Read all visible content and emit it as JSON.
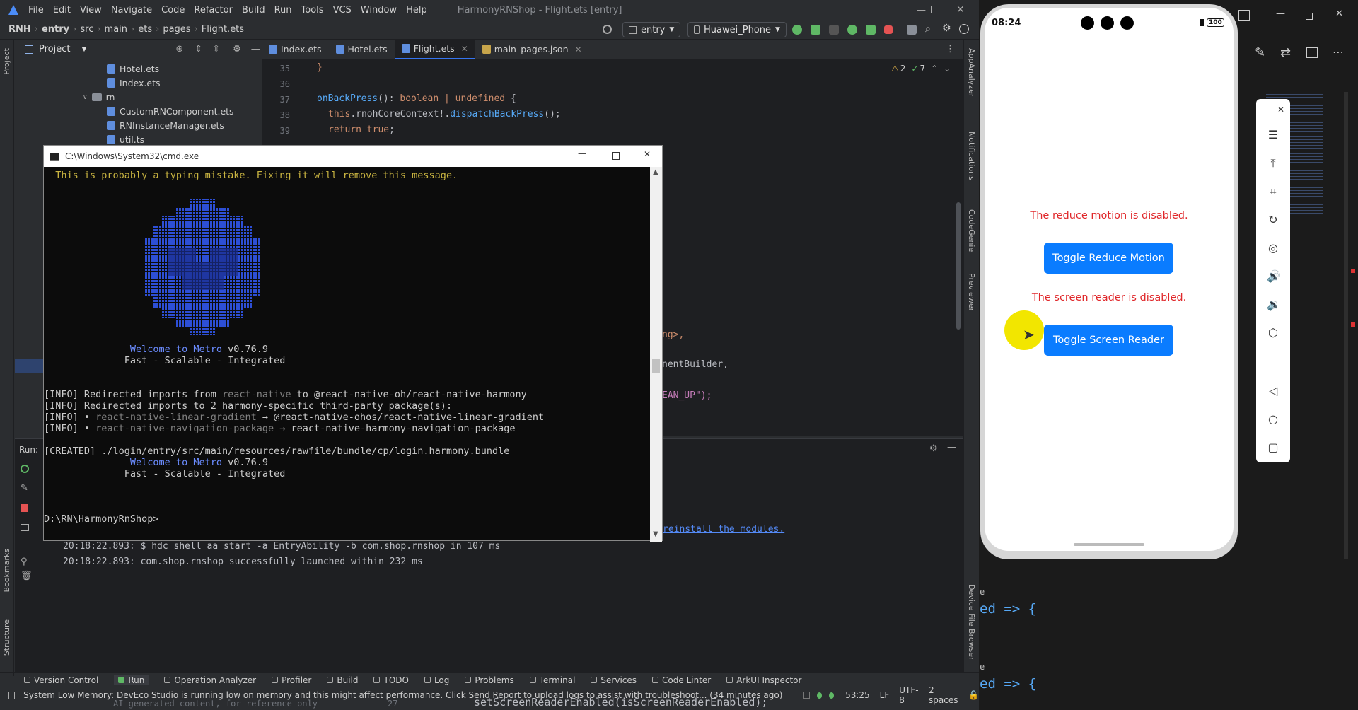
{
  "ide": {
    "menu": [
      "File",
      "Edit",
      "View",
      "Navigate",
      "Code",
      "Refactor",
      "Build",
      "Run",
      "Tools",
      "VCS",
      "Window",
      "Help"
    ],
    "window_title": "HarmonyRNShop - Flight.ets [entry]",
    "breadcrumb": [
      "RNH",
      "entry",
      "src",
      "main",
      "ets",
      "pages",
      "Flight.ets"
    ],
    "run_config": "entry",
    "device": "Huawei_Phone",
    "project_label": "Project",
    "tree": [
      {
        "name": "Hotel.ets",
        "type": "file"
      },
      {
        "name": "Index.ets",
        "type": "file"
      },
      {
        "name": "rn",
        "type": "folder"
      },
      {
        "name": "CustomRNComponent.ets",
        "type": "file"
      },
      {
        "name": "RNInstanceManager.ets",
        "type": "file"
      },
      {
        "name": "util.ts",
        "type": "file"
      }
    ],
    "tabs": [
      {
        "label": "Index.ets",
        "active": false
      },
      {
        "label": "Hotel.ets",
        "active": false
      },
      {
        "label": "Flight.ets",
        "active": true
      },
      {
        "label": "main_pages.json",
        "active": false
      }
    ],
    "inspection": {
      "warnings": "2",
      "ok": "7"
    },
    "line_numbers": [
      "35",
      "36",
      "37",
      "38",
      "39"
    ],
    "code_lines": {
      "l35": "}",
      "l37_name": "onBackPress",
      "l37_rest": "(): ",
      "l37_type": "boolean | undefined",
      "l37_end": " {",
      "l38_this": "this",
      "l38_mid": ".rnohCoreContext!.",
      "l38_fn": "dispatchBackPress",
      "l38_end": "();",
      "l39_kw": "return true",
      "l39_end": ";"
    },
    "code_fragments": {
      "frag1": "ng>,",
      "frag2": "nentBuilder,",
      "frag3": "EAN_UP\");",
      "frag4": "reinstall the modules."
    },
    "run_label": "Run:",
    "run_log": [
      "20:18:22.893: $ hdc shell aa start -a EntryAbility -b com.shop.rnshop in 107 ms",
      "20:18:22.893: com.shop.rnshop successfully launched within 232 ms"
    ],
    "side_labels_left": [
      "Project",
      "Bookmarks",
      "Structure"
    ],
    "side_labels_right": [
      "AppAnalyzer",
      "Notifications",
      "CodeGenie",
      "Previewer",
      "Device File Browser"
    ],
    "bottom_tabs": [
      "Version Control",
      "Run",
      "Operation Analyzer",
      "Profiler",
      "Build",
      "TODO",
      "Log",
      "Problems",
      "Terminal",
      "Services",
      "Code Linter",
      "ArkUI Inspector"
    ],
    "status_message": "System Low Memory: DevEco Studio is running low on memory and this might affect performance. Click Send Report to upload logs to assist with troubleshoot... (34 minutes ago)",
    "status_right": [
      "53:25",
      "LF",
      "UTF-8",
      "2 spaces"
    ],
    "bottom_fragment": "setScreenReaderEnabled(isScreenReaderEnabled);",
    "bottom_fragment2": "AI generated content, for reference only",
    "bottom_fragment_ln": "27"
  },
  "cmd": {
    "title": "C:\\Windows\\System32\\cmd.exe",
    "lines": {
      "typo": "  This is probably a typing mistake. Fixing it will remove this message.",
      "welcome1_a": "               Welcome to Metro",
      "welcome1_b": " v0.76.9",
      "fast1": "              Fast - Scalable - Integrated",
      "info1_a": "[INFO] Redirected imports from ",
      "info1_b": "react-native",
      "info1_c": " to @react-native-oh/react-native-harmony",
      "info2": "[INFO] Redirected imports to 2 harmony-specific third-party package(s):",
      "info3_a": "[INFO] • ",
      "info3_b": "react-native-linear-gradient",
      "info3_c": " → @react-native-ohos/react-native-linear-gradient",
      "info4_a": "[INFO] • ",
      "info4_b": "react-native-navigation-package",
      "info4_c": " → react-native-harmony-navigation-package",
      "created": "[CREATED] ./login/entry/src/main/resources/rawfile/bundle/cp/login.harmony.bundle",
      "welcome2_a": "               Welcome to Metro",
      "welcome2_b": " v0.76.9",
      "fast2": "              Fast - Scalable - Integrated",
      "prompt": "D:\\RN\\HarmonyRnShop>"
    }
  },
  "phone": {
    "time": "08:24",
    "battery": "100",
    "reduce_motion_text": "The reduce motion is disabled.",
    "reduce_motion_button": "Toggle Reduce Motion",
    "screen_reader_text": "The screen reader is disabled.",
    "screen_reader_button": "Toggle Screen Reader"
  },
  "vscode_fragments": {
    "line1": "ed => {",
    "line2": "ed => {",
    "prefix1": "e",
    "prefix2": "e"
  },
  "colors": {
    "accent": "#3574f0",
    "button_blue": "#0a7cff",
    "status_red": "#e0282b",
    "cursor_highlight": "#f2e600"
  }
}
